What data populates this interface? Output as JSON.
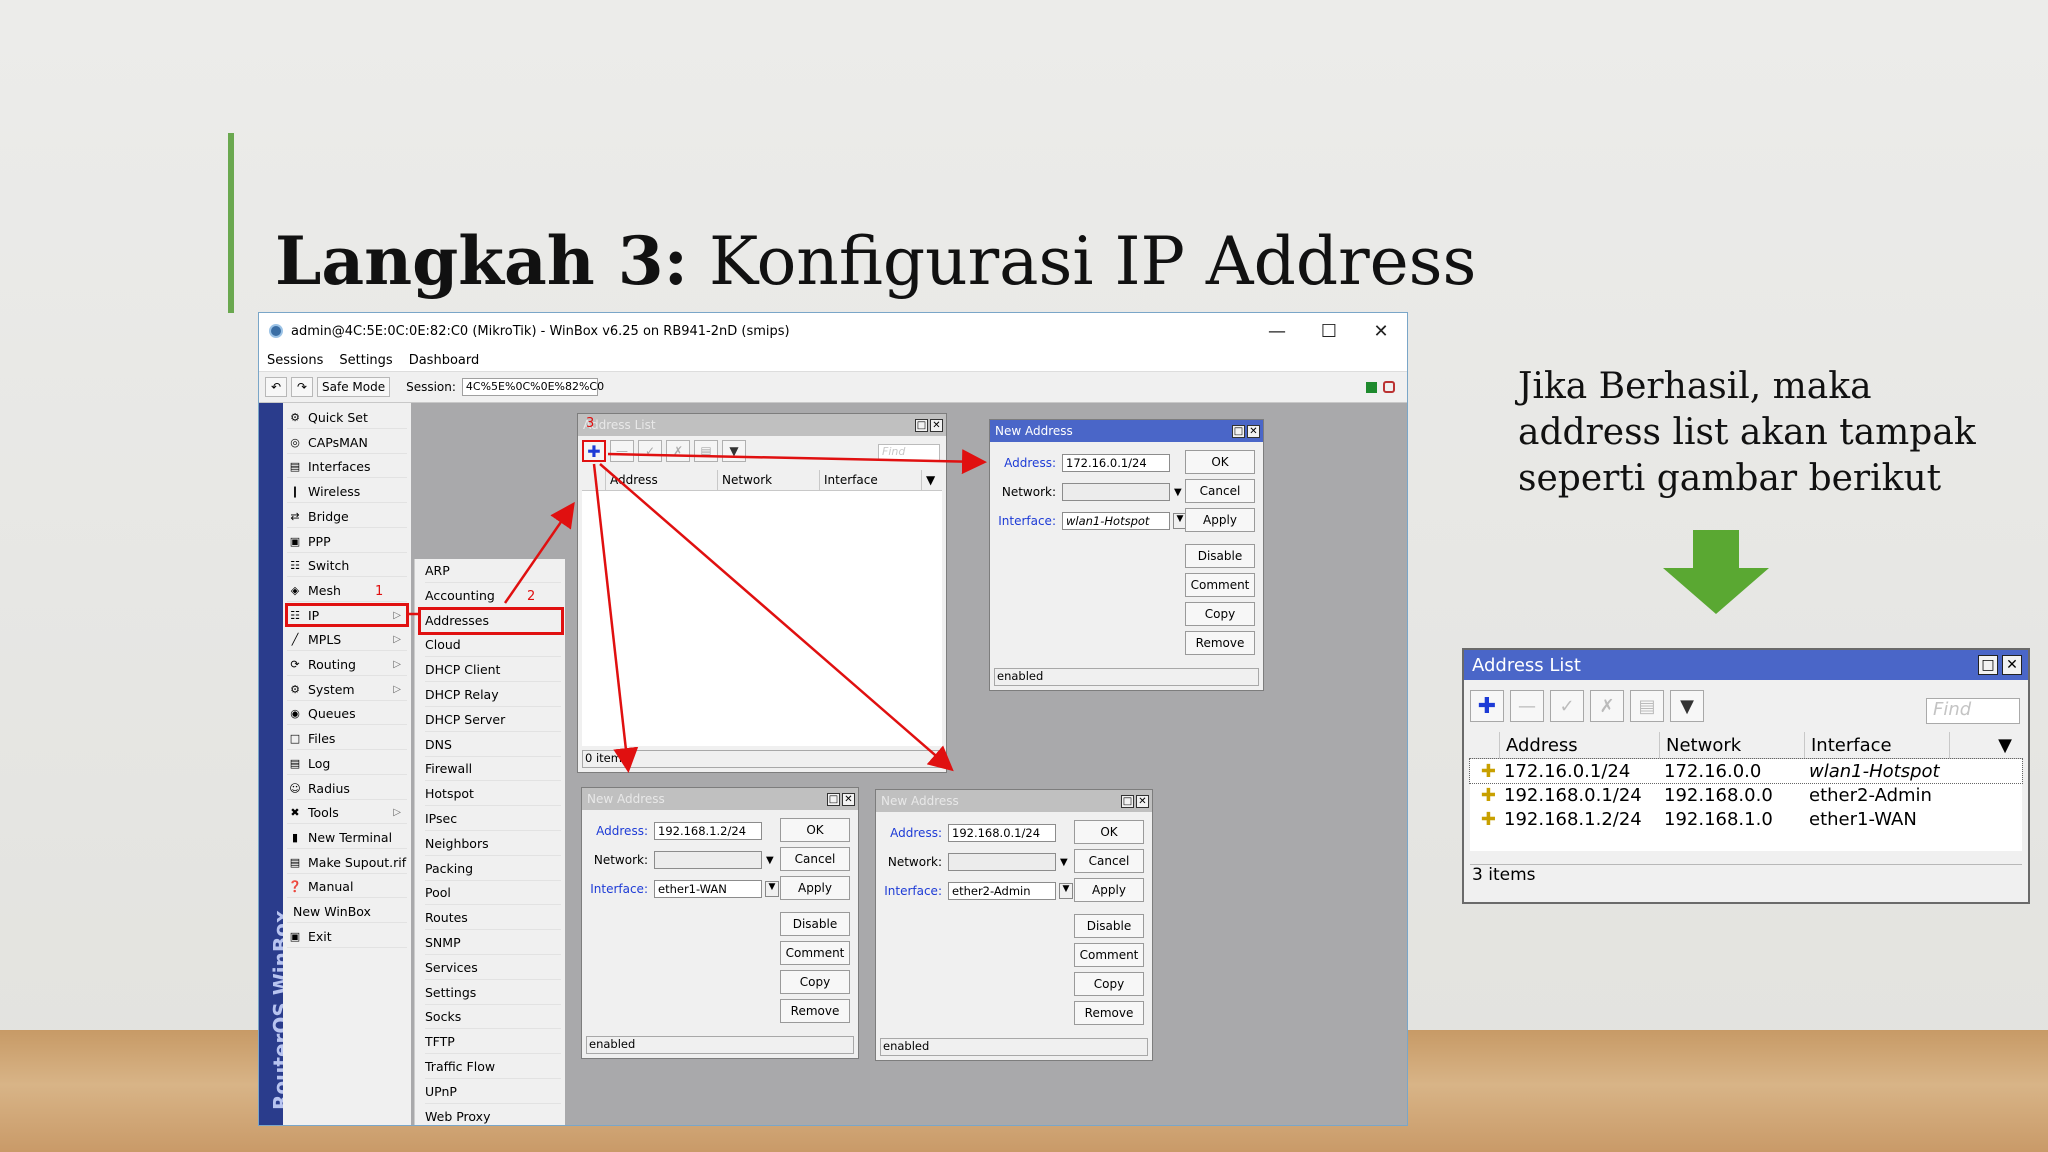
{
  "slide": {
    "title_bold": "Langkah 3:",
    "title_rest": " Konfigurasi IP Address",
    "side_text": "Jika Berhasil, maka address list akan tampak seperti gambar berikut",
    "accent_color": "#6aa84f"
  },
  "winbox": {
    "title": "admin@4C:5E:0C:0E:82:C0 (MikroTik) - WinBox v6.25 on RB941-2nD (smips)",
    "menu": [
      "Sessions",
      "Settings",
      "Dashboard"
    ],
    "toolbar": {
      "safe_mode": "Safe Mode",
      "session_label": "Session:",
      "session_value": "4C%5E%0C%0E%82%C0"
    },
    "brand": "RouterOS WinBox",
    "sidebar": [
      {
        "label": "Quick Set",
        "icon": "quickset-icon"
      },
      {
        "label": "CAPsMAN",
        "icon": "capsman-icon"
      },
      {
        "label": "Interfaces",
        "icon": "interfaces-icon"
      },
      {
        "label": "Wireless",
        "icon": "wireless-icon"
      },
      {
        "label": "Bridge",
        "icon": "bridge-icon"
      },
      {
        "label": "PPP",
        "icon": "ppp-icon"
      },
      {
        "label": "Switch",
        "icon": "switch-icon"
      },
      {
        "label": "Mesh",
        "icon": "mesh-icon"
      },
      {
        "label": "IP",
        "icon": "ip-icon"
      },
      {
        "label": "MPLS",
        "icon": "mpls-icon"
      },
      {
        "label": "Routing",
        "icon": "routing-icon"
      },
      {
        "label": "System",
        "icon": "system-icon"
      },
      {
        "label": "Queues",
        "icon": "queues-icon"
      },
      {
        "label": "Files",
        "icon": "files-icon"
      },
      {
        "label": "Log",
        "icon": "log-icon"
      },
      {
        "label": "Radius",
        "icon": "radius-icon"
      },
      {
        "label": "Tools",
        "icon": "tools-icon"
      },
      {
        "label": "New Terminal",
        "icon": "terminal-icon"
      },
      {
        "label": "Make Supout.rif",
        "icon": "supout-icon"
      },
      {
        "label": "Manual",
        "icon": "manual-icon"
      },
      {
        "label": "New WinBox",
        "icon": ""
      },
      {
        "label": "Exit",
        "icon": "exit-icon"
      }
    ],
    "submenu": [
      "ARP",
      "Accounting",
      "Addresses",
      "Cloud",
      "DHCP Client",
      "DHCP Relay",
      "DHCP Server",
      "DNS",
      "Firewall",
      "Hotspot",
      "IPsec",
      "Neighbors",
      "Packing",
      "Pool",
      "Routes",
      "SNMP",
      "Services",
      "Settings",
      "Socks",
      "TFTP",
      "Traffic Flow",
      "UPnP",
      "Web Proxy"
    ],
    "step_labels": [
      "1",
      "2",
      "3"
    ],
    "address_list_window": {
      "title": "Address List",
      "find": "Find",
      "columns": [
        "Address",
        "Network",
        "Interface"
      ],
      "status": "0 items"
    },
    "new_address_dialogs": [
      {
        "title": "New Address",
        "address": "172.16.0.1/24",
        "network": "",
        "interface": "wlan1-Hotspot",
        "status": "enabled"
      },
      {
        "title": "New Address",
        "address": "192.168.1.2/24",
        "network": "",
        "interface": "ether1-WAN",
        "status": "enabled"
      },
      {
        "title": "New Address",
        "address": "192.168.0.1/24",
        "network": "",
        "interface": "ether2-Admin",
        "status": "enabled"
      }
    ],
    "field_labels": {
      "address": "Address:",
      "network": "Network:",
      "interface": "Interface:"
    },
    "dialog_buttons": [
      "OK",
      "Cancel",
      "Apply",
      "Disable",
      "Comment",
      "Copy",
      "Remove"
    ]
  },
  "result_list": {
    "title": "Address List",
    "find": "Find",
    "columns": [
      "Address",
      "Network",
      "Interface"
    ],
    "rows": [
      {
        "address": "172.16.0.1/24",
        "network": "172.16.0.0",
        "interface": "wlan1-Hotspot"
      },
      {
        "address": "192.168.0.1/24",
        "network": "192.168.0.0",
        "interface": "ether2-Admin"
      },
      {
        "address": "192.168.1.2/24",
        "network": "192.168.1.0",
        "interface": "ether1-WAN"
      }
    ],
    "status": "3 items"
  },
  "colors": {
    "title_bar_blue": "#4a66c8",
    "annotation_red": "#e01010",
    "arrow_green": "#5aa832"
  }
}
